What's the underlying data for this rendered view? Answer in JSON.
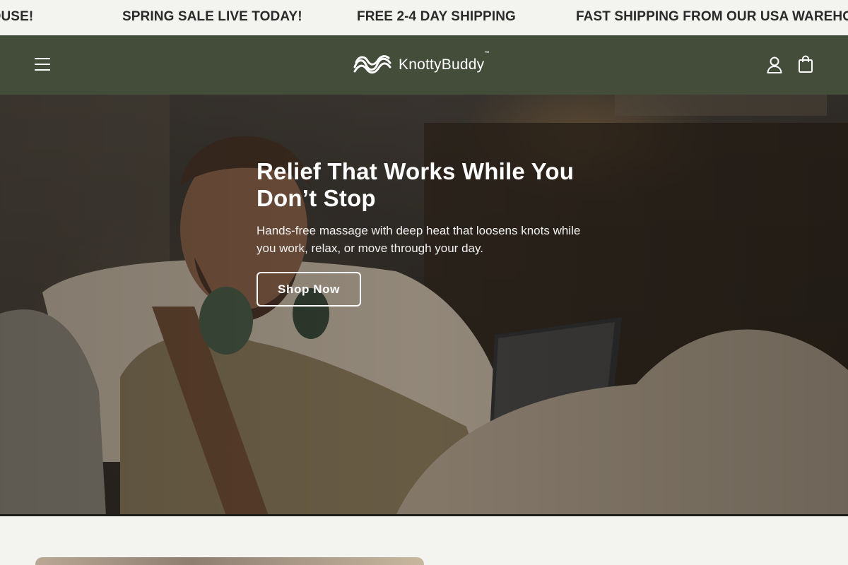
{
  "announcement": {
    "messages": [
      "FAST SHIPPING FROM OUR USA WAREHOUSE!",
      "SPRING SALE LIVE TODAY!",
      "FREE 2-4 DAY SHIPPING",
      "FAST SHIPPING FROM OUR USA WAREHOUSE!"
    ],
    "partial_left": "EHOUSE!"
  },
  "header": {
    "brand": "KnottyBuddy",
    "trademark": "™",
    "icons": [
      "menu-icon",
      "account-icon",
      "cart-icon"
    ],
    "background": "#434d3a"
  },
  "hero": {
    "title": "Relief That Works While You Don’t Stop",
    "subtitle": "Hands-free massage with deep heat that loosens knots while you work, relax, or move through your day.",
    "cta_label": "Shop Now"
  }
}
